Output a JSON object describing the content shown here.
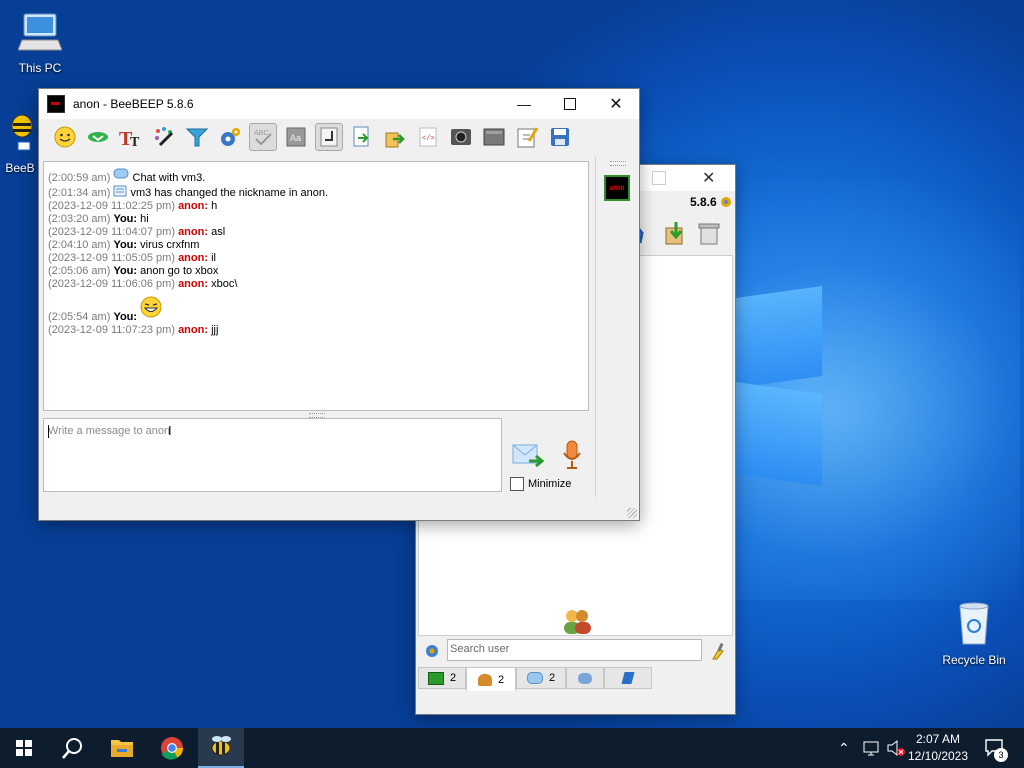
{
  "desktop": {
    "this_pc_label": "This PC",
    "beebeep_label": "BeeB",
    "recycle_bin_label": "Recycle Bin"
  },
  "chat_window": {
    "title": "anon - BeeBEEP 5.8.6",
    "toolbar_icons": [
      "emoticon-icon",
      "send-file-icon",
      "font-icon",
      "font-color-icon",
      "filter-icon",
      "settings-icon",
      "spellcheck-icon",
      "word-completer-icon",
      "use-return-key-icon",
      "save-chat-icon",
      "share-icon",
      "html-icon",
      "screenshot-icon",
      "clear-icon",
      "edit-icon",
      "save-icon"
    ],
    "messages": [
      {
        "time": "(2:00:59 am)",
        "icon": "chat",
        "text": "Chat with vm3."
      },
      {
        "time": "(2:01:34 am)",
        "icon": "info",
        "text": "vm3 has changed the nickname in anon."
      },
      {
        "time": "(2023-12-09 11:02:25 pm)",
        "sender": "anon:",
        "text": "h"
      },
      {
        "time": "(2:03:20 am)",
        "sender": "You:",
        "text": "hi"
      },
      {
        "time": "(2023-12-09 11:04:07 pm)",
        "sender": "anon:",
        "text": "asl"
      },
      {
        "time": "(2:04:10 am)",
        "sender": "You:",
        "text": "virus crxfnm"
      },
      {
        "time": "(2023-12-09 11:05:05 pm)",
        "sender": "anon:",
        "text": "il"
      },
      {
        "time": "(2:05:06 am)",
        "sender": "You:",
        "text": "anon go to xbox"
      },
      {
        "time": "(2023-12-09 11:06:06 pm)",
        "sender": "anon:",
        "text": "xboc\\"
      },
      {
        "time": "(2:05:54 am)",
        "sender": "You:",
        "emoji": "grin"
      },
      {
        "time": "(2023-12-09 11:07:23 pm)",
        "sender": "anon:",
        "text": "jjj"
      }
    ],
    "input_placeholder": "Write a message to anon",
    "minimize_label": "Minimize",
    "avatar_text": "ANON"
  },
  "main_window": {
    "version": "5.8.6",
    "search_placeholder": "Search user",
    "tabs": [
      {
        "icon": "users-online-icon",
        "count": "2"
      },
      {
        "icon": "contacts-icon",
        "count": "2"
      },
      {
        "icon": "chats-icon",
        "count": "2"
      },
      {
        "icon": "groups-icon",
        "count": ""
      },
      {
        "icon": "network-icon",
        "count": ""
      }
    ]
  },
  "taskbar": {
    "time": "2:07 AM",
    "date": "12/10/2023",
    "notification_count": "3"
  }
}
